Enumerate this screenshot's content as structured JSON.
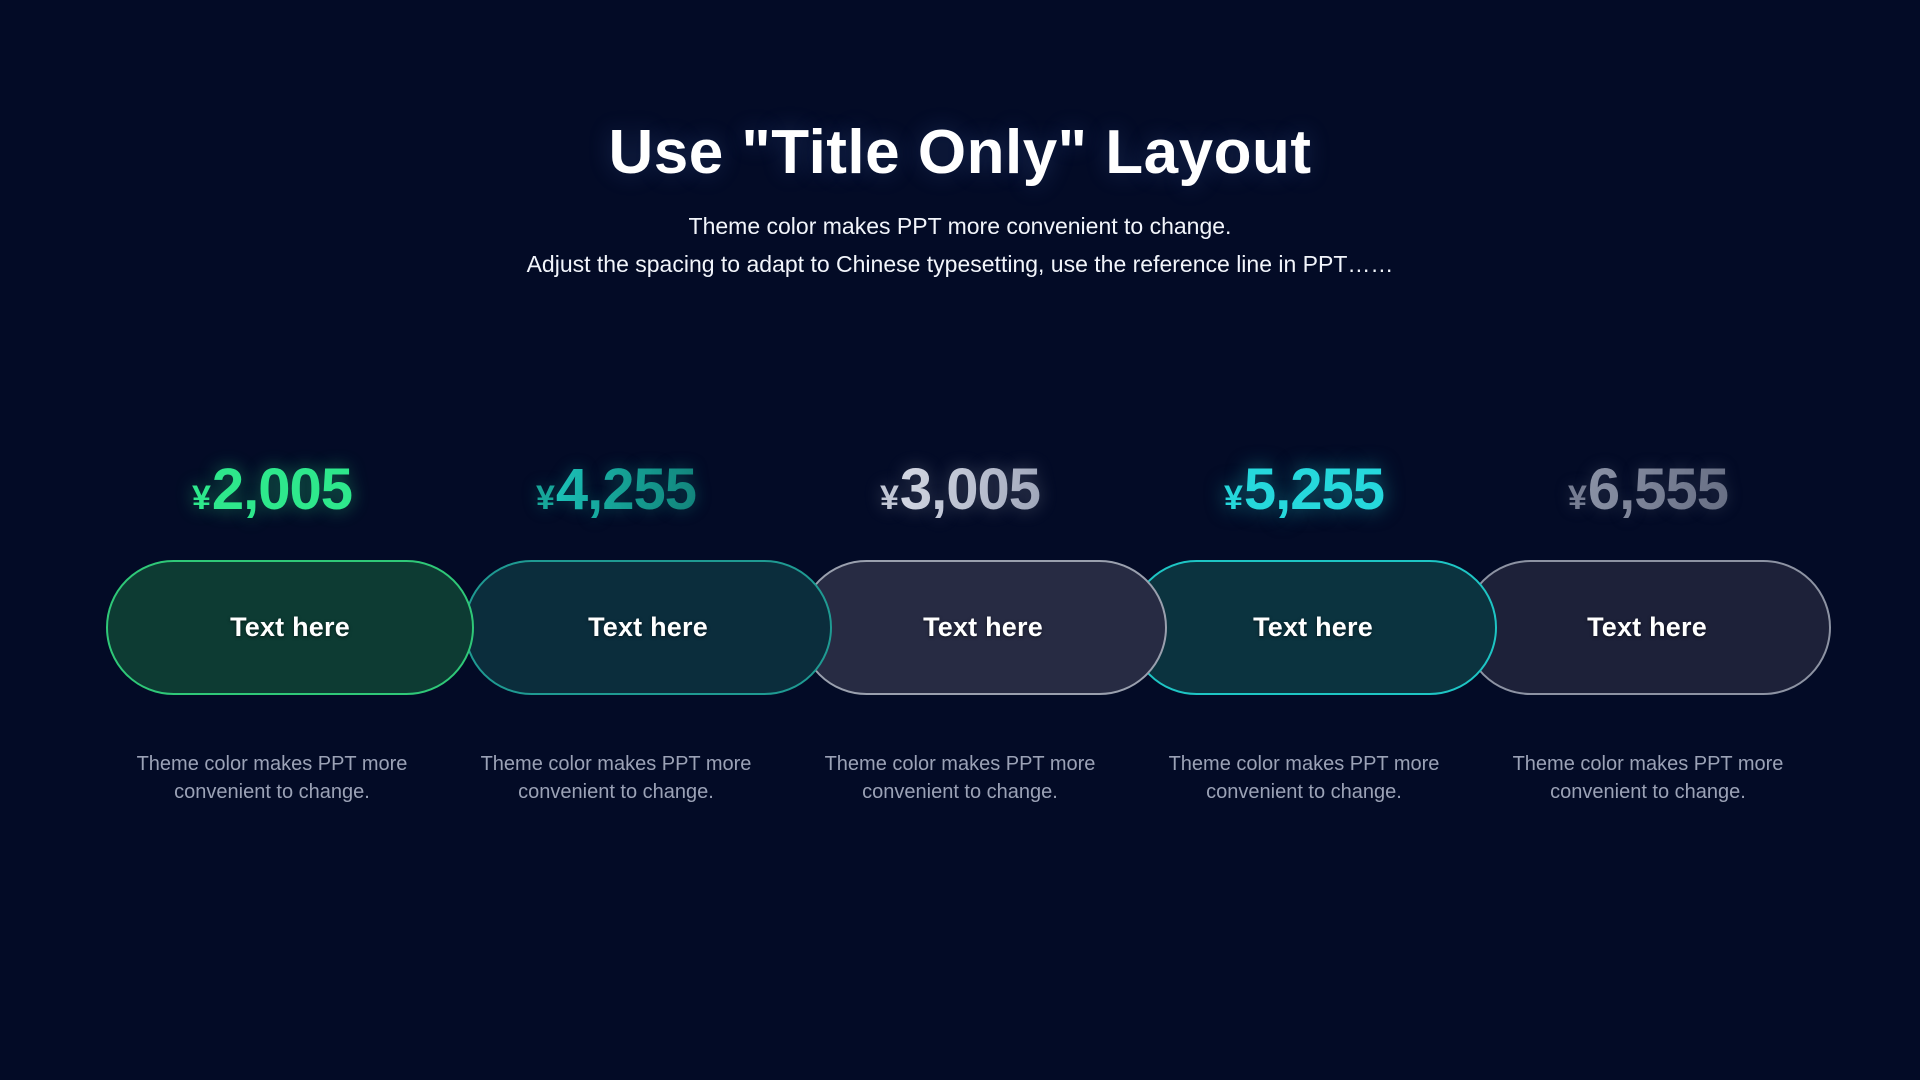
{
  "header": {
    "title": "Use \"Title Only\" Layout",
    "subtitle_line1": "Theme color makes PPT more convenient to change.",
    "subtitle_line2": "Adjust the spacing to adapt to Chinese typesetting, use the reference line in PPT……"
  },
  "colors": {
    "background": "#030b26",
    "title_text": "#ffffff",
    "subtitle_text": "#f2f5fb",
    "caption_text": "#9ba2b6",
    "accent_green": "#2ee88c",
    "accent_teal": "#18a79a",
    "accent_silver": "#c2c7d4",
    "accent_cyan": "#26d8dc",
    "accent_gray": "#767d92"
  },
  "currency_symbol": "¥",
  "items": [
    {
      "price": "2,005",
      "currency": "¥",
      "price_color": "#2ee88c",
      "pill_label": "Text here",
      "pill_border": "#2fc878",
      "pill_fill": "#0d3b33",
      "caption": "Theme color makes PPT more convenient to change."
    },
    {
      "price": "4,255",
      "currency": "¥",
      "price_color": "#18a79a",
      "pill_label": "Text here",
      "pill_border": "#1f9a92",
      "pill_fill": "#0b2d3c",
      "caption": "Theme color makes PPT more convenient to change."
    },
    {
      "price": "3,005",
      "currency": "¥",
      "price_color": "#c2c7d4",
      "pill_label": "Text here",
      "pill_border": "#9aa0ae",
      "pill_fill": "#272b43",
      "caption": "Theme color makes PPT more convenient to change."
    },
    {
      "price": "5,255",
      "currency": "¥",
      "price_color": "#26d8dc",
      "pill_label": "Text here",
      "pill_border": "#1ec5c4",
      "pill_fill": "#0b333f",
      "caption": "Theme color makes PPT more convenient to change."
    },
    {
      "price": "6,555",
      "currency": "¥",
      "price_color": "#767d92",
      "pill_label": "Text here",
      "pill_border": "#8d93a3",
      "pill_fill": "#1d2139",
      "caption": "Theme color makes PPT more convenient to change."
    }
  ]
}
